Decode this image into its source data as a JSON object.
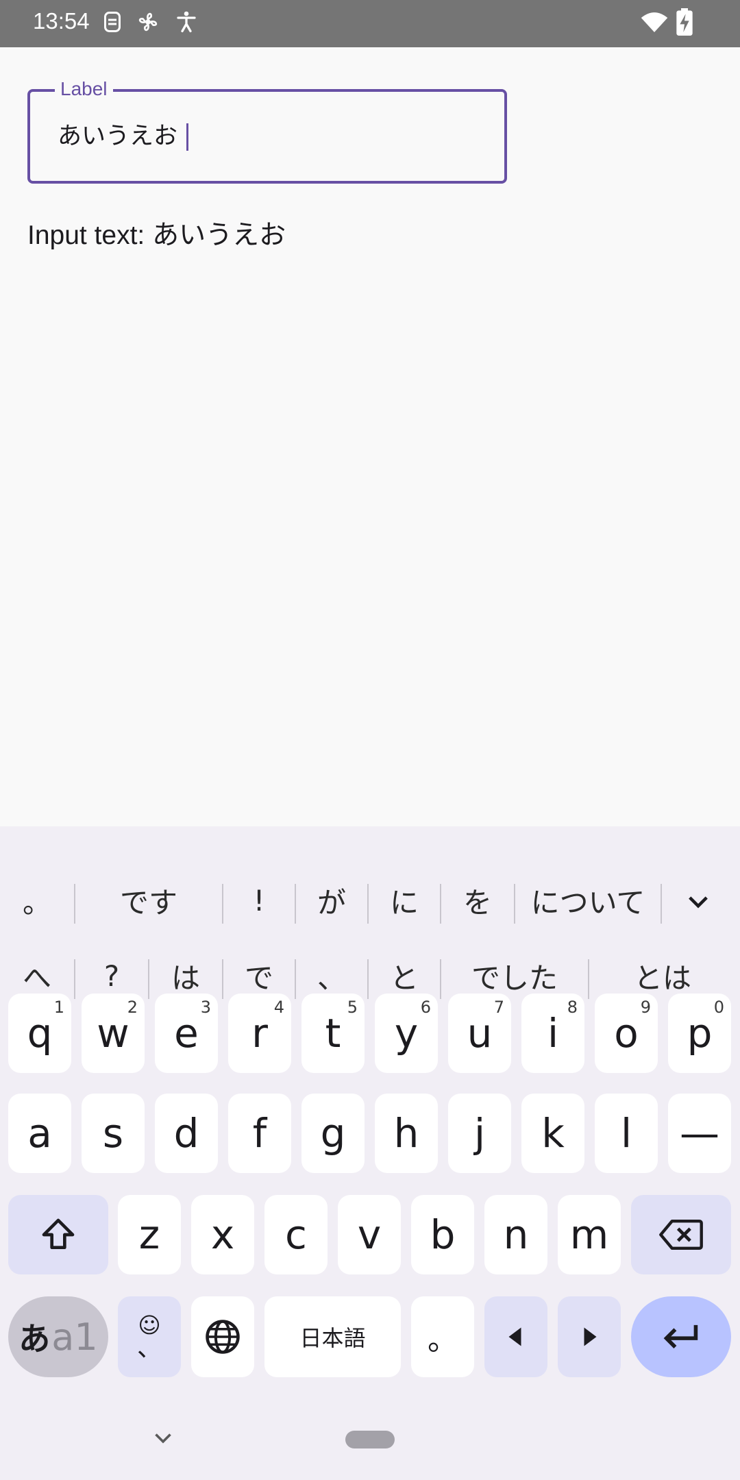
{
  "status_bar": {
    "time": "13:54",
    "icons": [
      "sim-icon",
      "fan-icon",
      "accessibility-icon",
      "wifi-icon",
      "battery-charging-icon"
    ]
  },
  "text_field": {
    "label": "Label",
    "value": "あいうえお"
  },
  "input_text": "Input text: あいうえお",
  "keyboard": {
    "suggestions_row1": [
      "。",
      "です",
      "!",
      "が",
      "に",
      "を",
      "について"
    ],
    "suggestions_row2": [
      "へ",
      "?",
      "は",
      "で",
      "、",
      "と",
      "でした",
      "とは"
    ],
    "row1": [
      {
        "key": "q",
        "hint": "1"
      },
      {
        "key": "w",
        "hint": "2"
      },
      {
        "key": "e",
        "hint": "3"
      },
      {
        "key": "r",
        "hint": "4"
      },
      {
        "key": "t",
        "hint": "5"
      },
      {
        "key": "y",
        "hint": "6"
      },
      {
        "key": "u",
        "hint": "7"
      },
      {
        "key": "i",
        "hint": "8"
      },
      {
        "key": "o",
        "hint": "9"
      },
      {
        "key": "p",
        "hint": "0"
      }
    ],
    "row2": [
      "a",
      "s",
      "d",
      "f",
      "g",
      "h",
      "j",
      "k",
      "l",
      "—"
    ],
    "row3": [
      "z",
      "x",
      "c",
      "v",
      "b",
      "n",
      "m"
    ],
    "lang_toggle": {
      "primary": "あ",
      "secondary": "a1"
    },
    "emoji_key": {
      "top": "☺",
      "bottom": "、"
    },
    "space_label": "日本語",
    "period_key": "。",
    "colors": {
      "accent": "#6750a4",
      "enter_bg": "#b8c3ff",
      "mod_bg": "#e0e0f6"
    }
  }
}
